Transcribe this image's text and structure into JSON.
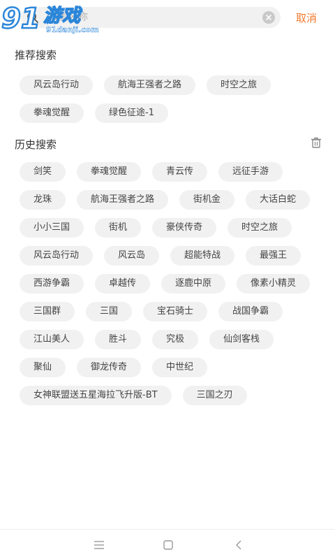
{
  "watermark": {
    "logo_text": "91",
    "title": "游戏",
    "url": "91danji.com"
  },
  "search": {
    "placeholder": "搜索名称",
    "cancel_label": "取消"
  },
  "recommended": {
    "title": "推荐搜索",
    "items": [
      "风云岛行动",
      "航海王强者之路",
      "时空之旅",
      "拳魂觉醒",
      "绿色征途-1"
    ]
  },
  "history": {
    "title": "历史搜索",
    "items": [
      "剑笑",
      "拳魂觉醒",
      "青云传",
      "远征手游",
      "龙珠",
      "航海王强者之路",
      "街机金",
      "大话白蛇",
      "小小三国",
      "街机",
      "豪侠传奇",
      "时空之旅",
      "风云岛行动",
      "风云岛",
      "超能特战",
      "最强王",
      "西游争霸",
      "卓越传",
      "逐鹿中原",
      "像素小精灵",
      "三国群",
      "三国",
      "宝石骑士",
      "战国争霸",
      "江山美人",
      "胜斗",
      "究极",
      "仙剑客栈",
      "聚仙",
      "御龙传奇",
      "中世纪",
      "女神联盟送五星海拉飞升版-BT",
      "三国之刃"
    ]
  },
  "colors": {
    "accent": "#f07a2e",
    "chip_bg": "#f1f1f1",
    "watermark_blue": "#2b86d9"
  },
  "icons": {
    "search": "search-icon",
    "clear": "clear-icon",
    "trash": "trash-icon",
    "nav_menu": "menu-icon",
    "nav_home": "home-icon",
    "nav_back": "back-icon"
  }
}
